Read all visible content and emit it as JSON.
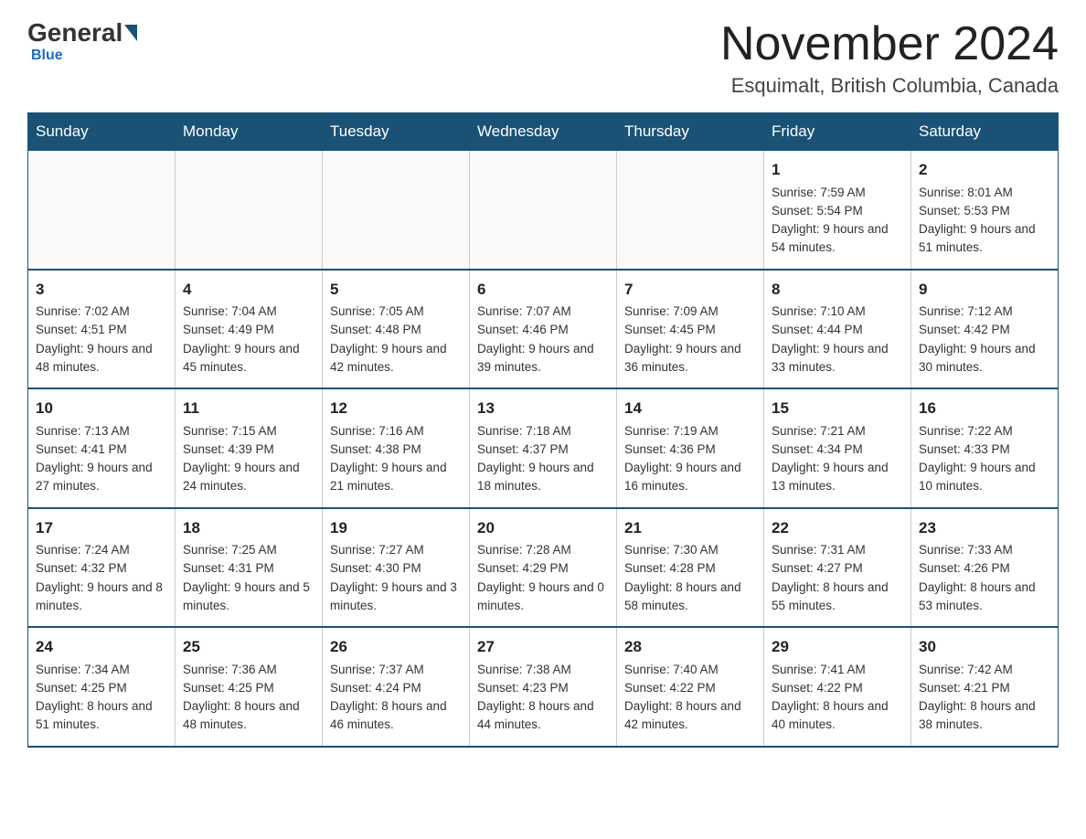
{
  "header": {
    "logo_general": "General",
    "logo_blue": "Blue",
    "month_title": "November 2024",
    "location": "Esquimalt, British Columbia, Canada"
  },
  "days_of_week": [
    "Sunday",
    "Monday",
    "Tuesday",
    "Wednesday",
    "Thursday",
    "Friday",
    "Saturday"
  ],
  "weeks": [
    [
      {
        "day": "",
        "data": ""
      },
      {
        "day": "",
        "data": ""
      },
      {
        "day": "",
        "data": ""
      },
      {
        "day": "",
        "data": ""
      },
      {
        "day": "",
        "data": ""
      },
      {
        "day": "1",
        "data": "Sunrise: 7:59 AM\nSunset: 5:54 PM\nDaylight: 9 hours and 54 minutes."
      },
      {
        "day": "2",
        "data": "Sunrise: 8:01 AM\nSunset: 5:53 PM\nDaylight: 9 hours and 51 minutes."
      }
    ],
    [
      {
        "day": "3",
        "data": "Sunrise: 7:02 AM\nSunset: 4:51 PM\nDaylight: 9 hours and 48 minutes."
      },
      {
        "day": "4",
        "data": "Sunrise: 7:04 AM\nSunset: 4:49 PM\nDaylight: 9 hours and 45 minutes."
      },
      {
        "day": "5",
        "data": "Sunrise: 7:05 AM\nSunset: 4:48 PM\nDaylight: 9 hours and 42 minutes."
      },
      {
        "day": "6",
        "data": "Sunrise: 7:07 AM\nSunset: 4:46 PM\nDaylight: 9 hours and 39 minutes."
      },
      {
        "day": "7",
        "data": "Sunrise: 7:09 AM\nSunset: 4:45 PM\nDaylight: 9 hours and 36 minutes."
      },
      {
        "day": "8",
        "data": "Sunrise: 7:10 AM\nSunset: 4:44 PM\nDaylight: 9 hours and 33 minutes."
      },
      {
        "day": "9",
        "data": "Sunrise: 7:12 AM\nSunset: 4:42 PM\nDaylight: 9 hours and 30 minutes."
      }
    ],
    [
      {
        "day": "10",
        "data": "Sunrise: 7:13 AM\nSunset: 4:41 PM\nDaylight: 9 hours and 27 minutes."
      },
      {
        "day": "11",
        "data": "Sunrise: 7:15 AM\nSunset: 4:39 PM\nDaylight: 9 hours and 24 minutes."
      },
      {
        "day": "12",
        "data": "Sunrise: 7:16 AM\nSunset: 4:38 PM\nDaylight: 9 hours and 21 minutes."
      },
      {
        "day": "13",
        "data": "Sunrise: 7:18 AM\nSunset: 4:37 PM\nDaylight: 9 hours and 18 minutes."
      },
      {
        "day": "14",
        "data": "Sunrise: 7:19 AM\nSunset: 4:36 PM\nDaylight: 9 hours and 16 minutes."
      },
      {
        "day": "15",
        "data": "Sunrise: 7:21 AM\nSunset: 4:34 PM\nDaylight: 9 hours and 13 minutes."
      },
      {
        "day": "16",
        "data": "Sunrise: 7:22 AM\nSunset: 4:33 PM\nDaylight: 9 hours and 10 minutes."
      }
    ],
    [
      {
        "day": "17",
        "data": "Sunrise: 7:24 AM\nSunset: 4:32 PM\nDaylight: 9 hours and 8 minutes."
      },
      {
        "day": "18",
        "data": "Sunrise: 7:25 AM\nSunset: 4:31 PM\nDaylight: 9 hours and 5 minutes."
      },
      {
        "day": "19",
        "data": "Sunrise: 7:27 AM\nSunset: 4:30 PM\nDaylight: 9 hours and 3 minutes."
      },
      {
        "day": "20",
        "data": "Sunrise: 7:28 AM\nSunset: 4:29 PM\nDaylight: 9 hours and 0 minutes."
      },
      {
        "day": "21",
        "data": "Sunrise: 7:30 AM\nSunset: 4:28 PM\nDaylight: 8 hours and 58 minutes."
      },
      {
        "day": "22",
        "data": "Sunrise: 7:31 AM\nSunset: 4:27 PM\nDaylight: 8 hours and 55 minutes."
      },
      {
        "day": "23",
        "data": "Sunrise: 7:33 AM\nSunset: 4:26 PM\nDaylight: 8 hours and 53 minutes."
      }
    ],
    [
      {
        "day": "24",
        "data": "Sunrise: 7:34 AM\nSunset: 4:25 PM\nDaylight: 8 hours and 51 minutes."
      },
      {
        "day": "25",
        "data": "Sunrise: 7:36 AM\nSunset: 4:25 PM\nDaylight: 8 hours and 48 minutes."
      },
      {
        "day": "26",
        "data": "Sunrise: 7:37 AM\nSunset: 4:24 PM\nDaylight: 8 hours and 46 minutes."
      },
      {
        "day": "27",
        "data": "Sunrise: 7:38 AM\nSunset: 4:23 PM\nDaylight: 8 hours and 44 minutes."
      },
      {
        "day": "28",
        "data": "Sunrise: 7:40 AM\nSunset: 4:22 PM\nDaylight: 8 hours and 42 minutes."
      },
      {
        "day": "29",
        "data": "Sunrise: 7:41 AM\nSunset: 4:22 PM\nDaylight: 8 hours and 40 minutes."
      },
      {
        "day": "30",
        "data": "Sunrise: 7:42 AM\nSunset: 4:21 PM\nDaylight: 8 hours and 38 minutes."
      }
    ]
  ]
}
